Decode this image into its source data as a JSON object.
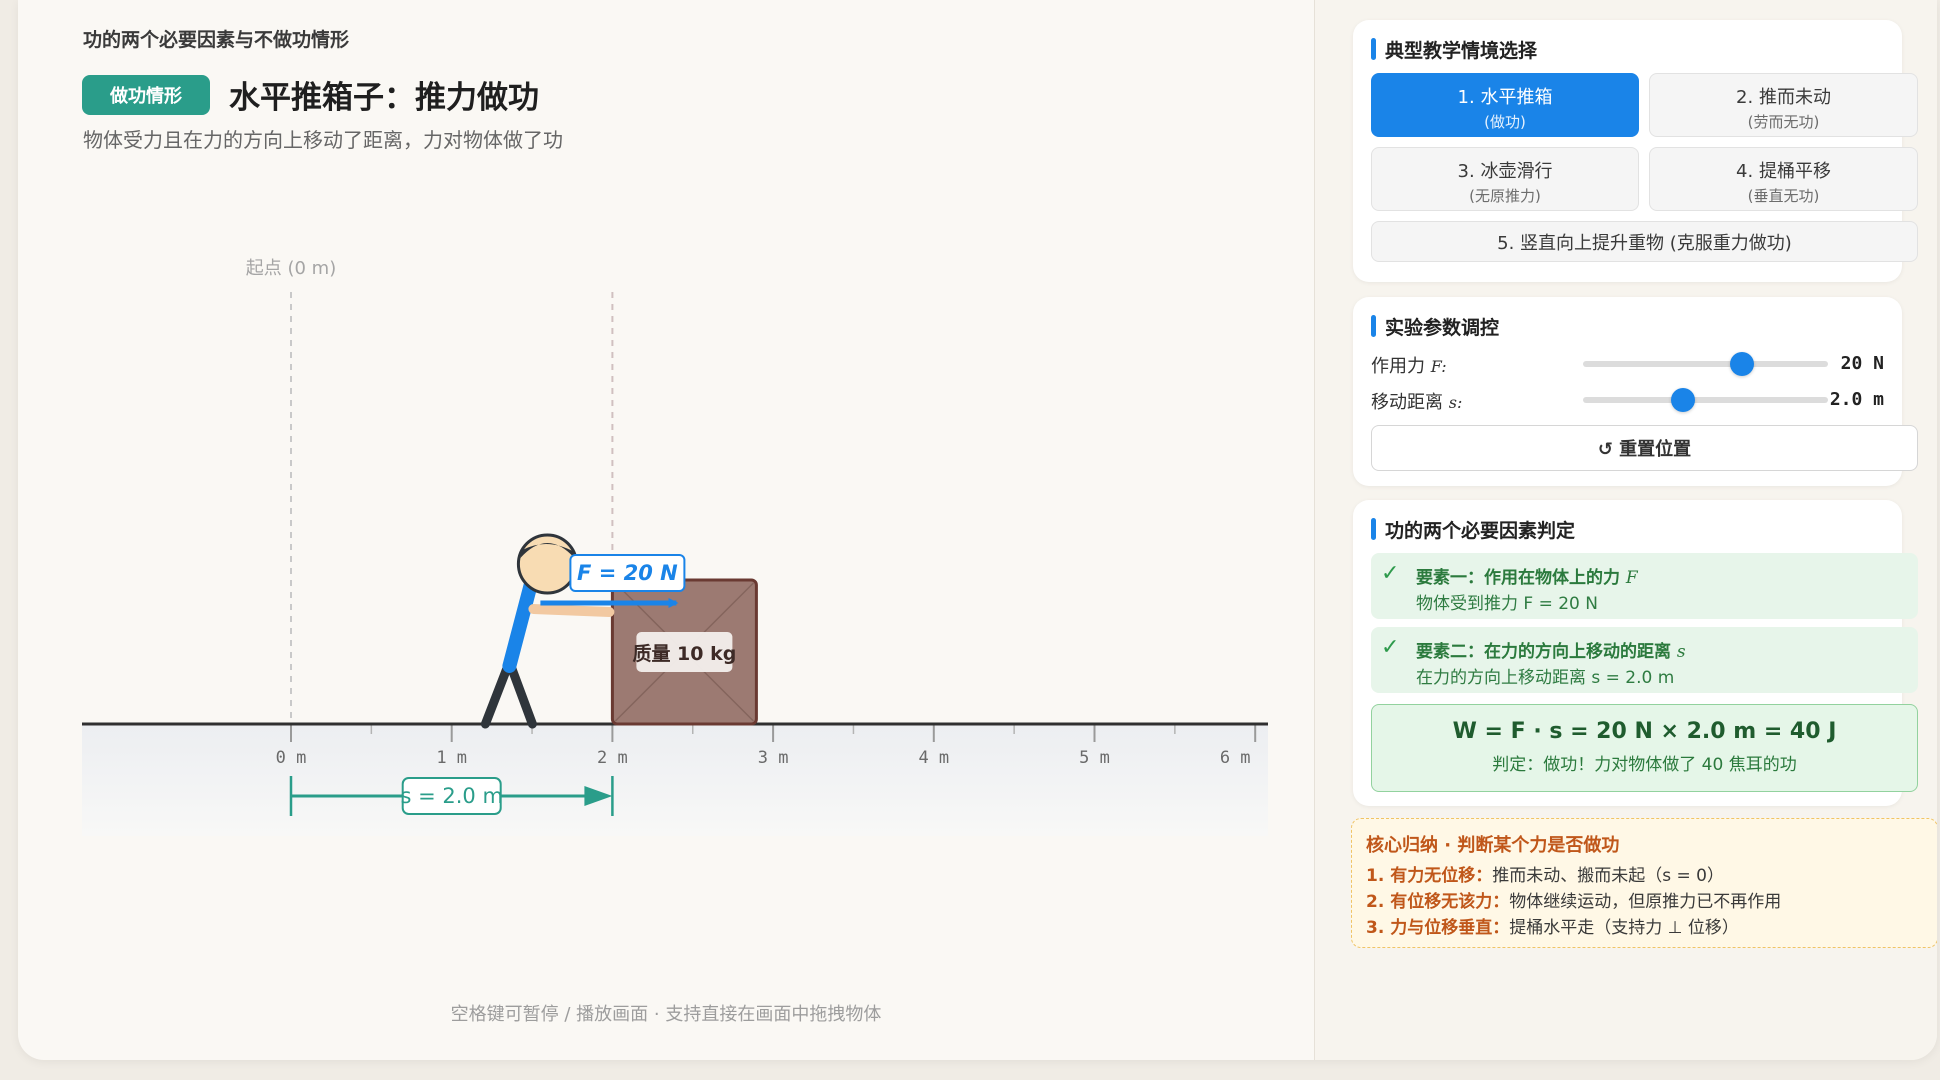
{
  "app_title": "功的两个必要因素与不做功情形",
  "scene": {
    "badge": "做功情形",
    "title": "水平推箱子：推力做功",
    "subtitle": "物体受力且在力的方向上移动了距离，力对物体做了功",
    "start_label": "起点 (0 m)",
    "force_label": "F = 20 N",
    "mass_label": "质量 10 kg",
    "distance_label": "s = 2.0 m",
    "ruler_ticks": [
      "0 m",
      "1 m",
      "2 m",
      "3 m",
      "4 m",
      "5 m",
      "6 m"
    ],
    "box_start_m": 2.0,
    "distance_m": 2.0,
    "hint": "空格键可暂停 / 播放画面 · 支持直接在画面中拖拽物体",
    "colors": {
      "force": "#1a84e8",
      "distance": "#2a9d8a",
      "box": "#9c7a72",
      "ground": "#2f2f2f"
    }
  },
  "scenarios": {
    "title": "典型教学情境选择",
    "options": [
      {
        "label": "1. 水平推箱",
        "sub": "(做功)",
        "active": true
      },
      {
        "label": "2. 推而未动",
        "sub": "(劳而无功)",
        "active": false
      },
      {
        "label": "3. 冰壶滑行",
        "sub": "(无原推力)",
        "active": false
      },
      {
        "label": "4. 提桶平移",
        "sub": "(垂直无功)",
        "active": false
      }
    ],
    "wide_option": "5. 竖直向上提升重物 (克服重力做功)"
  },
  "params": {
    "title": "实验参数调控",
    "force_label": "作用力",
    "force_symbol": "F:",
    "force_value": "20 N",
    "force_fraction": 0.65,
    "distance_label": "移动距离",
    "distance_symbol": "s:",
    "distance_value": "2.0 m",
    "distance_fraction": 0.41,
    "reset_label": "↺ 重置位置"
  },
  "judge": {
    "title": "功的两个必要因素判定",
    "factor1_title": "要素一：作用在物体上的力",
    "factor1_symbol": "F",
    "factor1_desc": "物体受到推力 F = 20 N",
    "factor2_title": "要素二：在力的方向上移动的距离",
    "factor2_symbol": "s",
    "factor2_desc": "在力的方向上移动距离 s = 2.0 m",
    "check": "✓",
    "formula": "W = F · s = 20 N × 2.0 m = 40 J",
    "verdict": "判定：做功！力对物体做了 40 焦耳的功"
  },
  "summary": {
    "title": "核心归纳 · 判断某个力是否做功",
    "r1_key": "1. 有力无位移：",
    "r1_text": "推而未动、搬而未起（s = 0）",
    "r2_key": "2. 有位移无该力：",
    "r2_text": "物体继续运动，但原推力已不再作用",
    "r3_key": "3. 力与位移垂直：",
    "r3_text": "提桶水平走（支持力 ⊥ 位移）"
  }
}
